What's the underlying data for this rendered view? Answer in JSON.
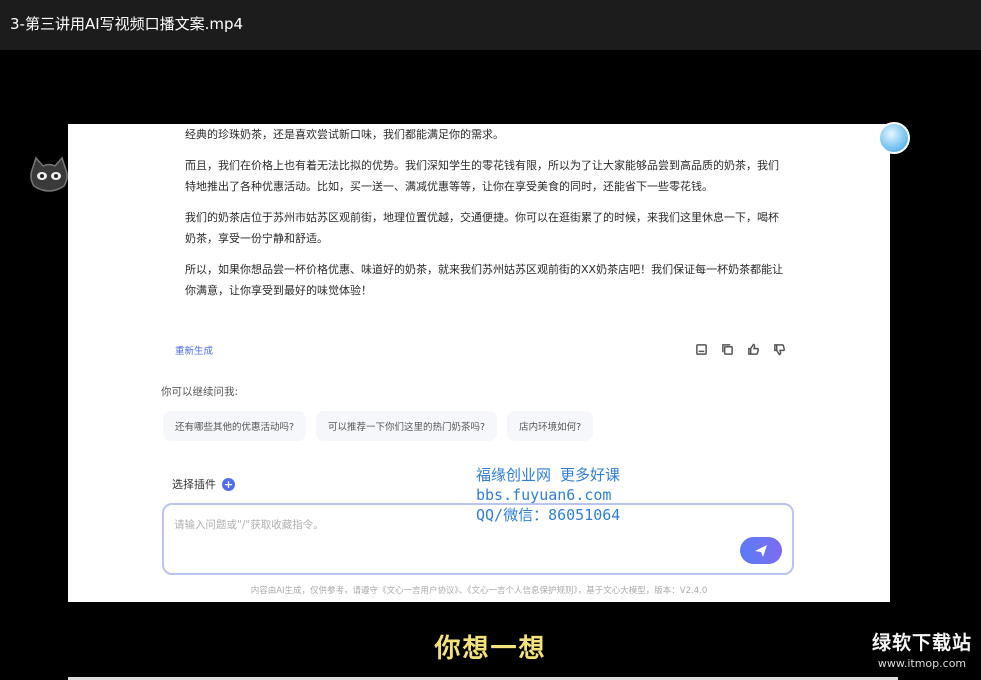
{
  "window": {
    "title": "3-第三讲用AI写视频口播文案.mp4"
  },
  "chat": {
    "answer_paragraphs": [
      "经典的珍珠奶茶，还是喜欢尝试新口味，我们都能满足你的需求。",
      "而且，我们在价格上也有着无法比拟的优势。我们深知学生的零花钱有限，所以为了让大家能够品尝到高品质的奶茶，我们特地推出了各种优惠活动。比如，买一送一、满减优惠等等，让你在享受美食的同时，还能省下一些零花钱。",
      "我们的奶茶店位于苏州市姑苏区观前街，地理位置优越，交通便捷。你可以在逛街累了的时候，来我们这里休息一下，喝杯奶茶，享受一份宁静和舒适。",
      "所以，如果你想品尝一杯价格优惠、味道好的奶茶，就来我们苏州姑苏区观前街的XX奶茶店吧！我们保证每一杯奶茶都能让你满意，让你享受到最好的味觉体验！"
    ],
    "regenerate_label": "重新生成",
    "action_icons": [
      "save-icon",
      "copy-icon",
      "thumbs-up-icon",
      "thumbs-down-icon"
    ],
    "suggest_heading": "你可以继续问我:",
    "suggestions": [
      "还有哪些其他的优惠活动吗?",
      "可以推荐一下你们这里的热门奶茶吗?",
      "店内环境如何?"
    ],
    "plugin_label": "选择插件",
    "input_placeholder": "请输入问题或\"/\"获取收藏指令。",
    "footer": "内容由AI生成，仅供参考，请遵守《文心一言用户协议》、《文心一言个人信息保护规则》，基于文心大模型，版本：V2.4.0"
  },
  "overlay": {
    "watermark_lines": [
      "福缘创业网 更多好课",
      "bbs.fuyuan6.com",
      "QQ/微信：86051064"
    ],
    "subtitle": "你想一想",
    "brand_name": "绿软下载站",
    "brand_url": "www.itmop.com"
  },
  "colors": {
    "accent": "#4e6ef2",
    "subtitle": "#f3e27a",
    "watermark": "#2f7fd8"
  }
}
